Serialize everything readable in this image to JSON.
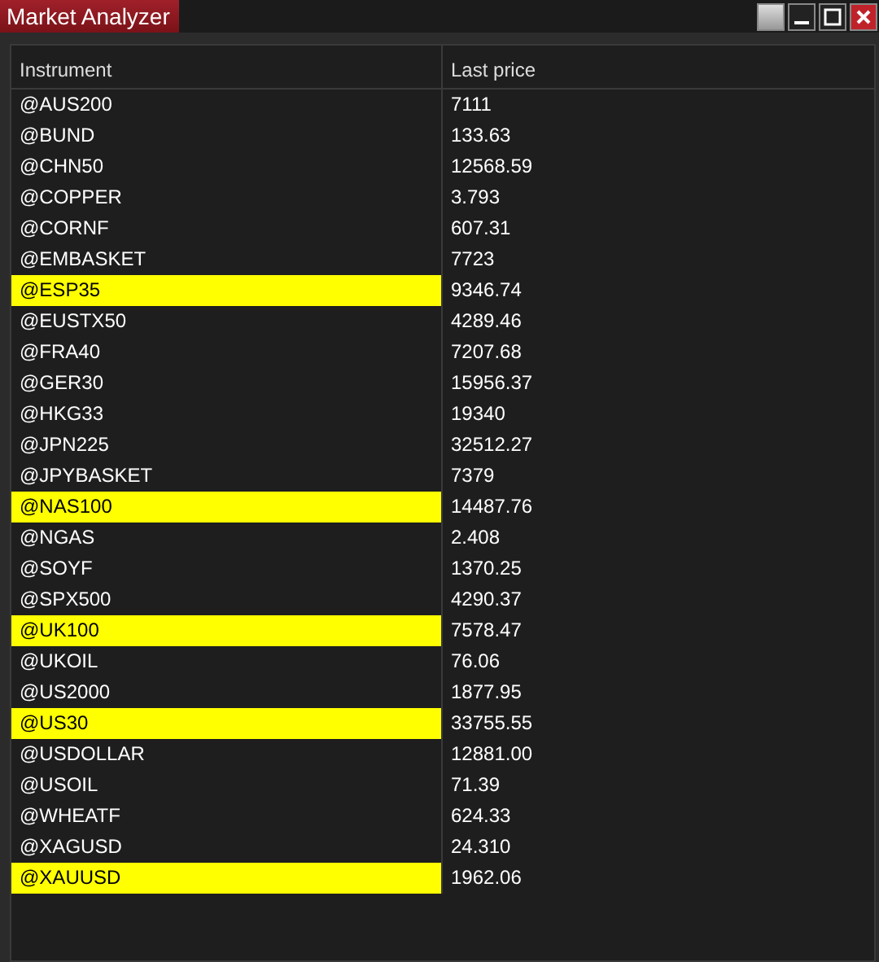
{
  "window": {
    "title": "Market Analyzer"
  },
  "table": {
    "columns": [
      "Instrument",
      "Last price"
    ],
    "rows": [
      {
        "instrument": "@AUS200",
        "last_price": "7111",
        "highlighted": false
      },
      {
        "instrument": "@BUND",
        "last_price": "133.63",
        "highlighted": false
      },
      {
        "instrument": "@CHN50",
        "last_price": "12568.59",
        "highlighted": false
      },
      {
        "instrument": "@COPPER",
        "last_price": "3.793",
        "highlighted": false
      },
      {
        "instrument": "@CORNF",
        "last_price": "607.31",
        "highlighted": false
      },
      {
        "instrument": "@EMBASKET",
        "last_price": "7723",
        "highlighted": false
      },
      {
        "instrument": "@ESP35",
        "last_price": "9346.74",
        "highlighted": true
      },
      {
        "instrument": "@EUSTX50",
        "last_price": "4289.46",
        "highlighted": false
      },
      {
        "instrument": "@FRA40",
        "last_price": "7207.68",
        "highlighted": false
      },
      {
        "instrument": "@GER30",
        "last_price": "15956.37",
        "highlighted": false
      },
      {
        "instrument": "@HKG33",
        "last_price": "19340",
        "highlighted": false
      },
      {
        "instrument": "@JPN225",
        "last_price": "32512.27",
        "highlighted": false
      },
      {
        "instrument": "@JPYBASKET",
        "last_price": "7379",
        "highlighted": false
      },
      {
        "instrument": "@NAS100",
        "last_price": "14487.76",
        "highlighted": true
      },
      {
        "instrument": "@NGAS",
        "last_price": "2.408",
        "highlighted": false
      },
      {
        "instrument": "@SOYF",
        "last_price": "1370.25",
        "highlighted": false
      },
      {
        "instrument": "@SPX500",
        "last_price": "4290.37",
        "highlighted": false
      },
      {
        "instrument": "@UK100",
        "last_price": "7578.47",
        "highlighted": true
      },
      {
        "instrument": "@UKOIL",
        "last_price": "76.06",
        "highlighted": false
      },
      {
        "instrument": "@US2000",
        "last_price": "1877.95",
        "highlighted": false
      },
      {
        "instrument": "@US30",
        "last_price": "33755.55",
        "highlighted": true
      },
      {
        "instrument": "@USDOLLAR",
        "last_price": "12881.00",
        "highlighted": false
      },
      {
        "instrument": "@USOIL",
        "last_price": "71.39",
        "highlighted": false
      },
      {
        "instrument": "@WHEATF",
        "last_price": "624.33",
        "highlighted": false
      },
      {
        "instrument": "@XAGUSD",
        "last_price": "24.310",
        "highlighted": false
      },
      {
        "instrument": "@XAUUSD",
        "last_price": "1962.06",
        "highlighted": true
      }
    ]
  }
}
